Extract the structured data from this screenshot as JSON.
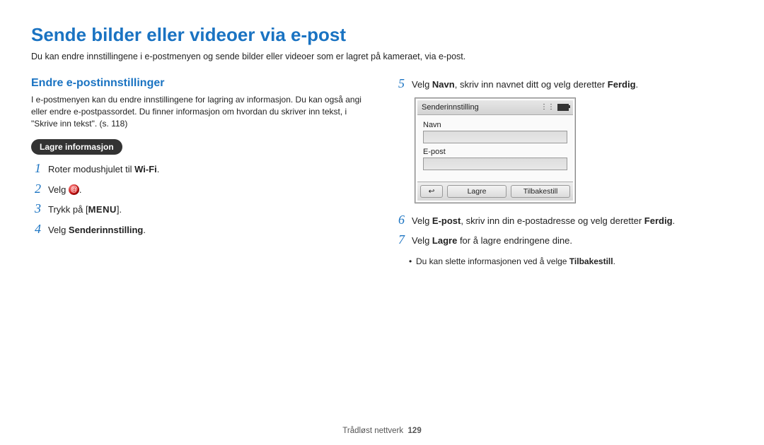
{
  "title": "Sende bilder eller videoer via e-post",
  "intro": "Du kan endre innstillingene i e-postmenyen og sende bilder eller videoer som er lagret på kameraet, via e-post.",
  "subhead_left": "Endre e-postinnstillinger",
  "para_left": "I e-postmenyen kan du endre innstillingene for lagring av informasjon. Du kan også angi eller endre e-postpassordet. Du finner informasjon om hvordan du skriver inn tekst, i \"Skrive inn tekst\". (s. 118)",
  "pill": "Lagre informasjon",
  "steps_left": {
    "s1_a": "Roter modushjulet til ",
    "s1_wifi": "Wi-Fi",
    "s1_b": ".",
    "s2_a": "Velg ",
    "s2_b": ".",
    "s3_a": "Trykk på [",
    "s3_menu": "MENU",
    "s3_b": "].",
    "s4_a": "Velg ",
    "s4_bold": "Senderinnstilling",
    "s4_b": "."
  },
  "steps_right": {
    "s5_a": "Velg ",
    "s5_b1": "Navn",
    "s5_c": ", skriv inn navnet ditt og velg deretter ",
    "s5_b2": "Ferdig",
    "s5_d": ".",
    "s6_a": "Velg ",
    "s6_b1": "E-post",
    "s6_c": ", skriv inn din e-postadresse og velg deretter ",
    "s6_b2": "Ferdig",
    "s6_d": ".",
    "s7_a": "Velg ",
    "s7_b1": "Lagre",
    "s7_c": " for å lagre endringene dine."
  },
  "device": {
    "header": "Senderinnstilling",
    "label_name": "Navn",
    "label_email": "E-post",
    "btn_back_glyph": "↩",
    "btn_save": "Lagre",
    "btn_reset": "Tilbakestill"
  },
  "note_a": "Du kan slette informasjonen ved å velge ",
  "note_bold": "Tilbakestill",
  "note_b": ".",
  "footer_section": "Trådløst nettverk",
  "footer_page": "129"
}
